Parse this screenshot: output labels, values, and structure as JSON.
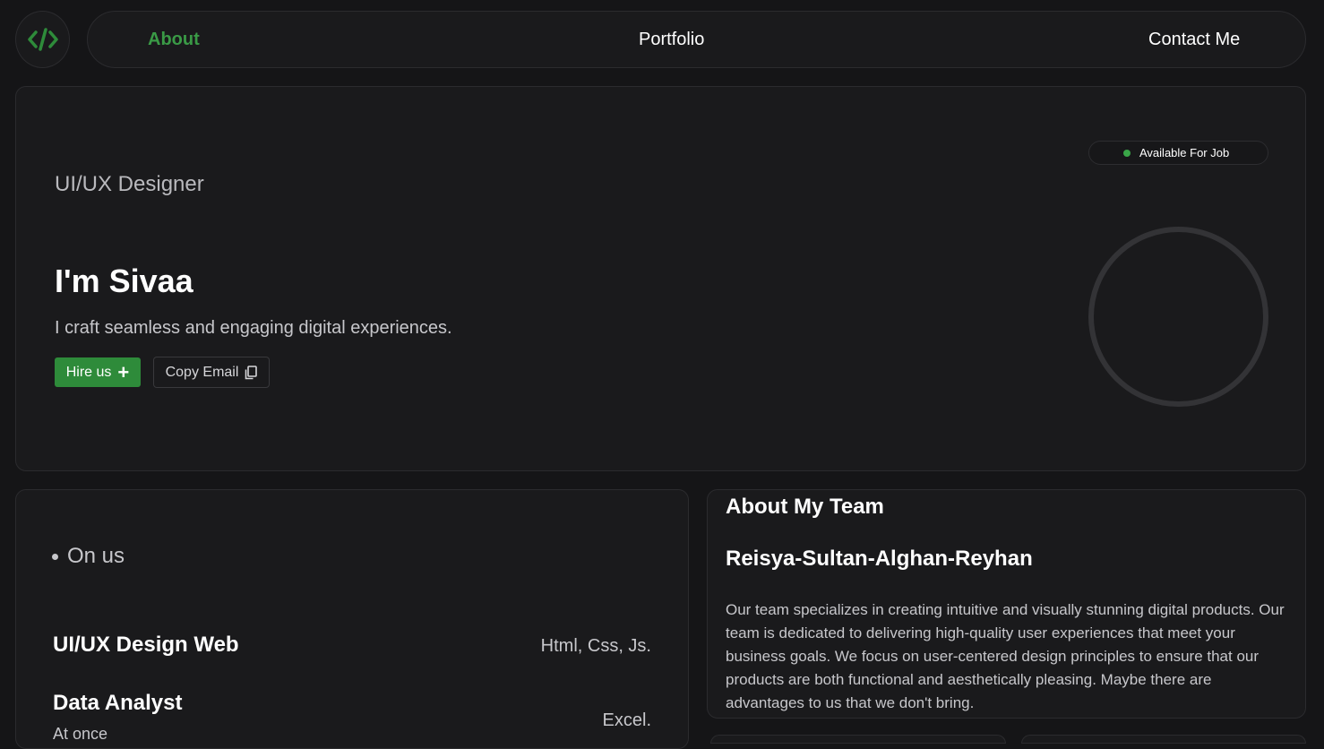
{
  "nav": {
    "logo_icon": "code-icon",
    "items": [
      {
        "label": "About",
        "active": true
      },
      {
        "label": "Portfolio",
        "active": false
      },
      {
        "label": "Contact Me",
        "active": false
      }
    ]
  },
  "hero": {
    "role": "UI/UX Designer",
    "name": "I'm Sivaa",
    "tagline": "I craft seamless and engaging digital experiences.",
    "hire_label": "Hire us",
    "copy_label": "Copy Email",
    "status": "Available For Job",
    "status_color": "#3aa648"
  },
  "services": {
    "heading": "On us",
    "items": [
      {
        "title": "UI/UX Design Web",
        "tools": "Html, Css, Js."
      },
      {
        "title": "Data Analyst",
        "tools": "Excel."
      }
    ],
    "partial_text": "At once"
  },
  "team": {
    "heading": "About My Team",
    "name": "Reisya-Sultan-Alghan-Reyhan",
    "description": "Our team specializes in creating intuitive and visually stunning digital products. Our team is dedicated to delivering high-quality user experiences that meet your business goals. We focus on user-centered design principles to ensure that our products are both functional and aesthetically pleasing. Maybe there are advantages to us that we don't bring."
  },
  "colors": {
    "accent": "#2e8b3a",
    "background": "#151517",
    "card": "#1a1a1c"
  }
}
